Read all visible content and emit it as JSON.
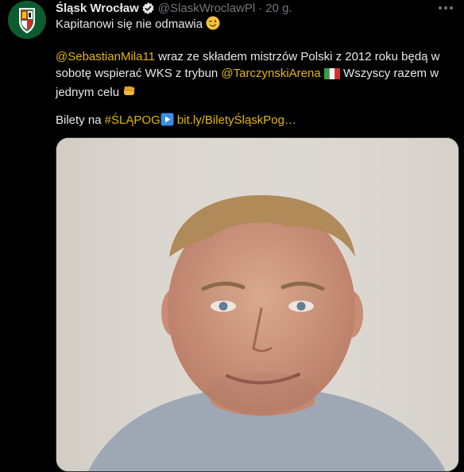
{
  "tweet": {
    "display_name": "Śląsk Wrocław",
    "handle": "@SlaskWroclawPl",
    "separator": "·",
    "time": "20 g.",
    "line1": "Kapitanowi się nie odmawia",
    "mention1": "@SebastianMila11",
    "text_a": " wraz ze składem mistrzów Polski z 2012 roku będą w sobotę wspierać WKS z trybun ",
    "mention2": "@TarczynskiArena",
    "text_b": " Wszyscy razem w jednym celu",
    "bilety_prefix": "Bilety na ",
    "hashtag": "#ŚLĄPOG",
    "link": "bit.ly/BiletyŚląskPog…"
  },
  "colors": {
    "background": "#000000",
    "text": "#e7e9ea",
    "muted": "#71767b",
    "accent": "#e6b800",
    "verified": "#e7e9ea"
  },
  "icons": {
    "verified": "verified-badge-icon",
    "more": "more-dots-icon",
    "emoji_wink": "winking-face-emoji",
    "emoji_flag": "italy-flag-emoji",
    "emoji_fist": "oncoming-fist-emoji",
    "emoji_play": "play-button-emoji"
  }
}
